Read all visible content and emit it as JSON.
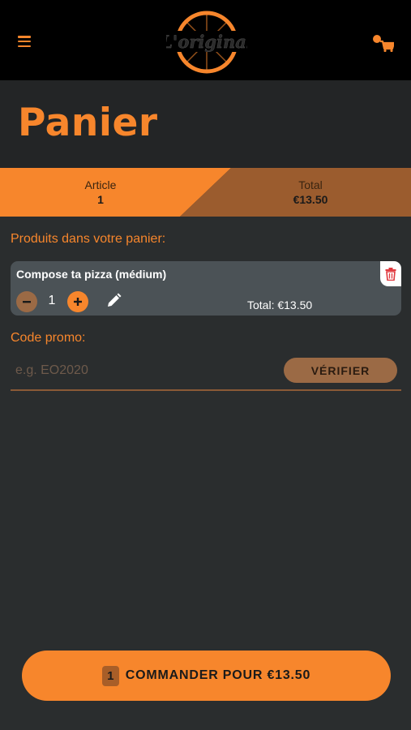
{
  "header": {
    "logo_text": "L'original",
    "menu_icon": "hamburger-icon",
    "cart_icon": "cart-icon"
  },
  "page": {
    "title": "Panier"
  },
  "summary": {
    "article_label": "Article",
    "article_value": "1",
    "total_label": "Total",
    "total_value": "€13.50"
  },
  "cart": {
    "heading": "Produits dans votre panier:",
    "items": [
      {
        "name": "Compose ta pizza (médium)",
        "quantity": "1",
        "total": "Total: €13.50",
        "delete_icon": "trash-icon",
        "edit_icon": "pencil-icon"
      }
    ]
  },
  "promo": {
    "label": "Code promo:",
    "placeholder": "e.g. EO2020",
    "verify_label": "VÉRIFIER"
  },
  "order": {
    "count": "1",
    "label": "COMMANDER POUR €13.50"
  },
  "colors": {
    "accent": "#f7862c",
    "accent_dark": "#9b6a45",
    "background": "#2a2d2e",
    "card": "#4b5256",
    "header": "#000000"
  }
}
